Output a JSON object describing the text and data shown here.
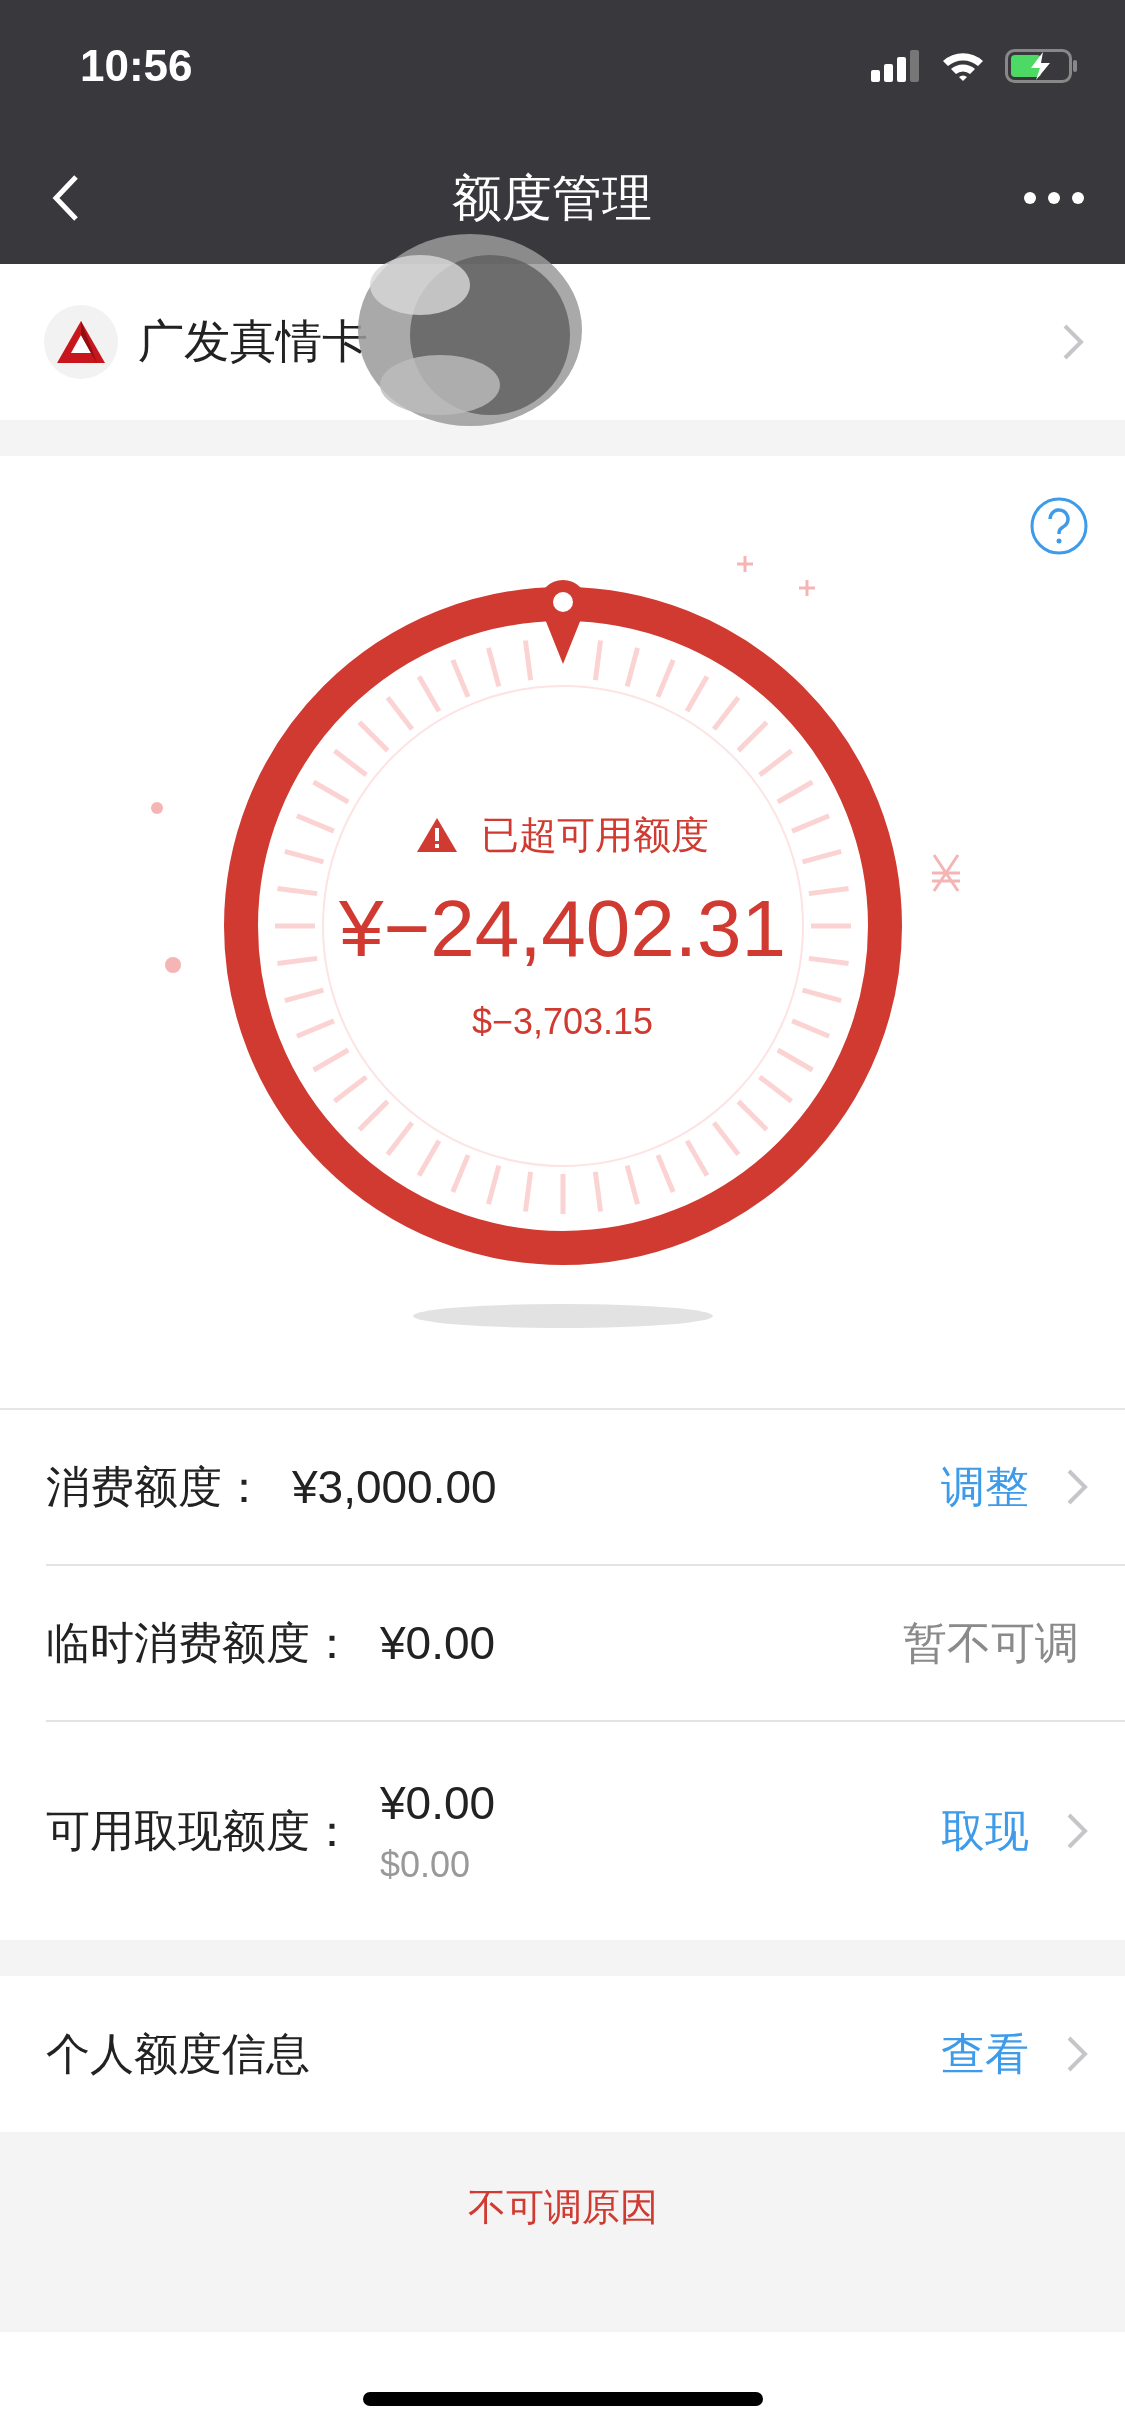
{
  "status_bar": {
    "time": "10:56"
  },
  "nav": {
    "title": "额度管理"
  },
  "card": {
    "name": "广发真情卡"
  },
  "dial": {
    "status": "已超可用额度",
    "amount": "¥−24,402.31",
    "amount_usd": "$−3,703.15"
  },
  "limits": [
    {
      "kind": "action",
      "label": "消费额度：",
      "value": "¥3,000.00",
      "action": "调整"
    },
    {
      "kind": "status",
      "label": "临时消费额度：",
      "value": "¥0.00",
      "status": "暂不可调"
    },
    {
      "kind": "action",
      "label": "可用取现额度：",
      "value": "¥0.00",
      "sub_value": "$0.00",
      "action": "取现"
    }
  ],
  "info": {
    "label": "个人额度信息",
    "action": "查看"
  },
  "footer_link": "不可调原因"
}
